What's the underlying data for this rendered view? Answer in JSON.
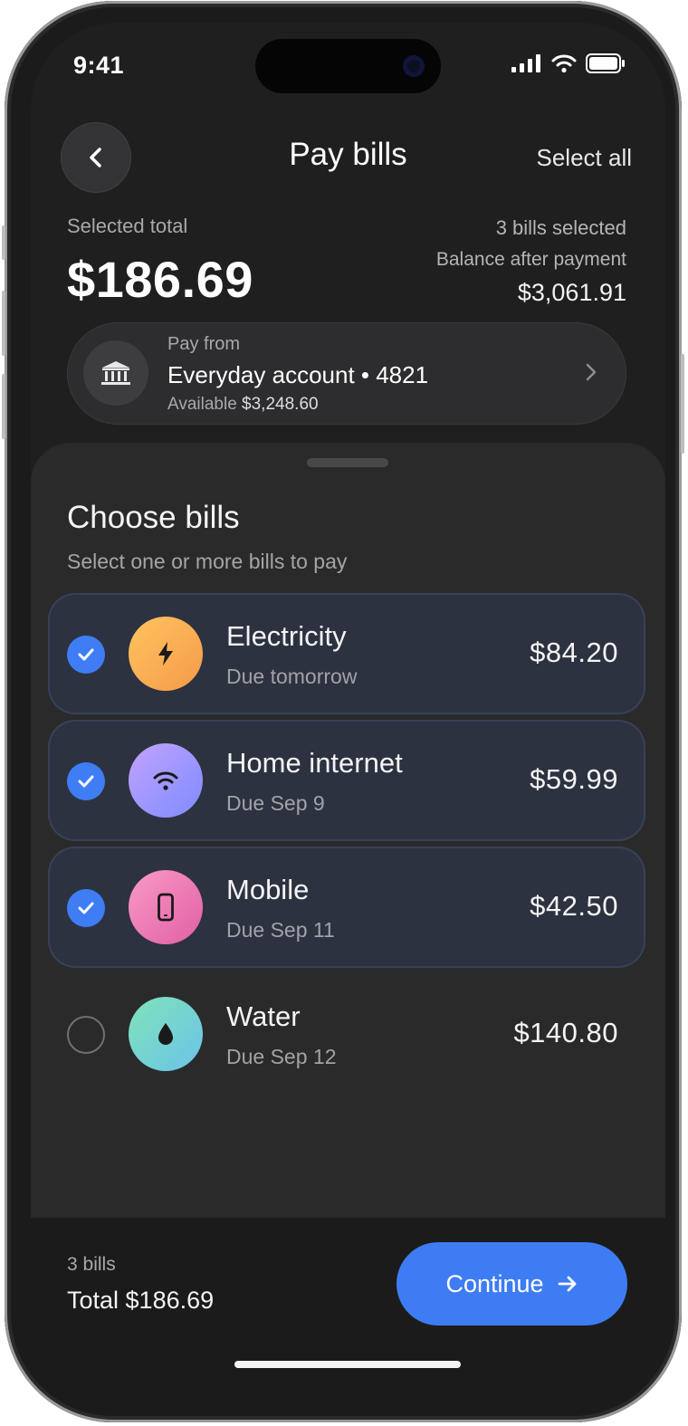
{
  "status_bar": {
    "time": "9:41"
  },
  "header": {
    "title": "Pay bills",
    "select_all_label": "Select all"
  },
  "summary": {
    "selected_total_label": "Selected total",
    "selected_total": "$186.69",
    "bills_selected": "3 bills selected",
    "balance_after_label": "Balance after payment",
    "balance_after": "$3,061.91"
  },
  "pay_from": {
    "label": "Pay from",
    "account": "Everyday account • 4821",
    "available_label": "Available",
    "available_amount": "$3,248.60"
  },
  "sheet": {
    "title": "Choose bills",
    "subtitle": "Select one or more bills to pay"
  },
  "bills": [
    {
      "name": "Electricity",
      "due": "Due tomorrow",
      "amount": "$84.20",
      "selected": true,
      "icon": "lightning-icon",
      "gradient": [
        "#ffc45e",
        "#f59a4a"
      ]
    },
    {
      "name": "Home internet",
      "due": "Due Sep 9",
      "amount": "$59.99",
      "selected": true,
      "icon": "wifi-icon",
      "gradient": [
        "#c3a3ff",
        "#7d8bff"
      ]
    },
    {
      "name": "Mobile",
      "due": "Due Sep 11",
      "amount": "$42.50",
      "selected": true,
      "icon": "phone-icon",
      "gradient": [
        "#f99ac4",
        "#e15fa6"
      ]
    },
    {
      "name": "Water",
      "due": "Due Sep 12",
      "amount": "$140.80",
      "selected": false,
      "icon": "water-drop-icon",
      "gradient": [
        "#7fe3b8",
        "#6bc3ea"
      ]
    }
  ],
  "footer": {
    "count": "3 bills",
    "total": "Total $186.69",
    "continue_label": "Continue"
  },
  "colors": {
    "accent": "#3e7cf4",
    "background": "#1f1f20",
    "sheet": "#2a2a2b",
    "selected_row": "#2d3240"
  }
}
